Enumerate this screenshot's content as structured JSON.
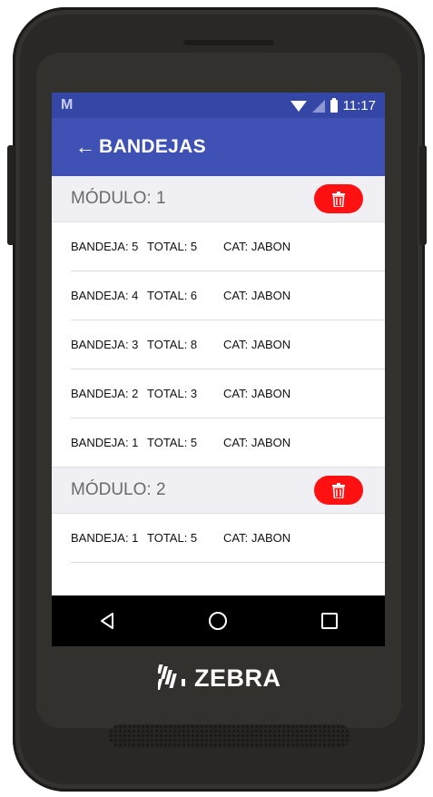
{
  "status_bar": {
    "notification_icon": "M",
    "time": "11:17"
  },
  "app_bar": {
    "back_icon": "←",
    "title": "BANDEJAS"
  },
  "modules": [
    {
      "label": "MÓDULO: 1",
      "rows": [
        {
          "bandeja": "BANDEJA: 5",
          "total": "TOTAL: 5",
          "cat": "CAT: JABON"
        },
        {
          "bandeja": "BANDEJA: 4",
          "total": "TOTAL: 6",
          "cat": "CAT: JABON"
        },
        {
          "bandeja": "BANDEJA: 3",
          "total": "TOTAL: 8",
          "cat": "CAT: JABON"
        },
        {
          "bandeja": "BANDEJA: 2",
          "total": "TOTAL: 3",
          "cat": "CAT: JABON"
        },
        {
          "bandeja": "BANDEJA: 1",
          "total": "TOTAL: 5",
          "cat": "CAT: JABON"
        }
      ]
    },
    {
      "label": "MÓDULO: 2",
      "rows": [
        {
          "bandeja": "BANDEJA: 1",
          "total": "TOTAL: 5",
          "cat": "CAT: JABON"
        }
      ]
    }
  ],
  "brand": {
    "name": "ZEBRA"
  },
  "colors": {
    "app_bar": "#3f51b5",
    "status_bar": "#3447a6",
    "delete_button": "#ff1111",
    "module_header_bg": "#efeff4"
  },
  "icons": {
    "delete": "trash-icon",
    "back": "arrow-left-icon",
    "nav_back": "triangle-back-icon",
    "nav_home": "circle-home-icon",
    "nav_recents": "square-recents-icon"
  }
}
